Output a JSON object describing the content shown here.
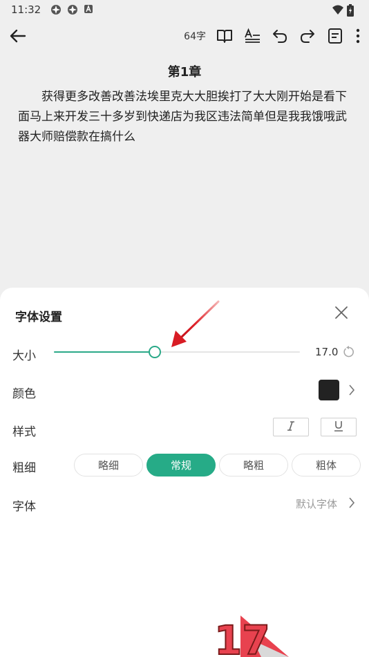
{
  "status_bar": {
    "time": "11:32",
    "icons": [
      "app-icon",
      "app-icon",
      "a-icon"
    ],
    "right_icons": [
      "wifi-icon",
      "battery-icon"
    ]
  },
  "toolbar": {
    "word_count": "64字",
    "icons": [
      "back-arrow-icon",
      "book-icon",
      "text-format-icon",
      "undo-icon",
      "redo-icon",
      "notes-icon",
      "more-vertical-icon"
    ]
  },
  "chapter": {
    "title": "第1章",
    "body": "获得更多改善改善法埃里克大大胆挨打了大大刚开始是看下面马上来开发三十多岁到快递店为我区违法简单但是我我饿哦武器大师赔偿款在搞什么"
  },
  "font_settings": {
    "title": "字体设置",
    "size": {
      "label": "大小",
      "value": "17.0",
      "fill_fraction": 0.41
    },
    "color": {
      "label": "颜色",
      "swatch": "#222222"
    },
    "style": {
      "label": "样式",
      "buttons": [
        "italic-icon",
        "underline-icon"
      ]
    },
    "weight": {
      "label": "粗细",
      "options": [
        "略细",
        "常规",
        "略粗",
        "粗体"
      ],
      "selected": "常规"
    },
    "font": {
      "label": "字体",
      "value": "默认字体"
    }
  },
  "colors": {
    "accent": "#26ab87",
    "annotation": "#e0242b",
    "background": "#efefef"
  },
  "watermark": {
    "text": "17"
  }
}
